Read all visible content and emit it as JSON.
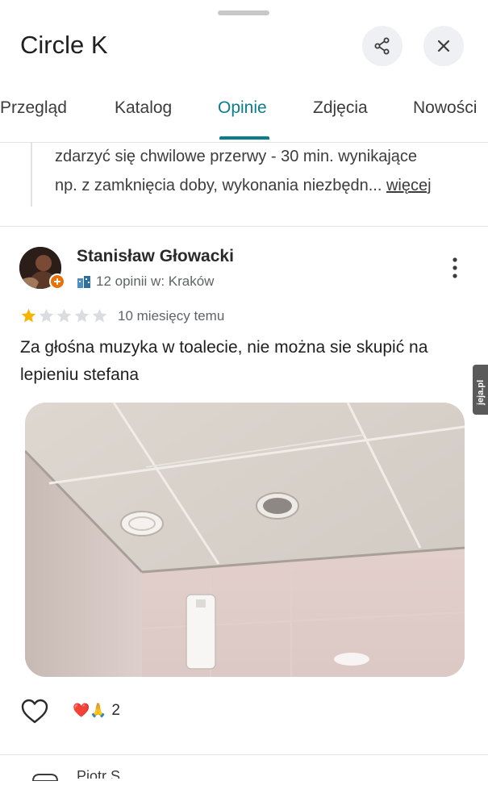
{
  "header": {
    "title": "Circle K"
  },
  "tabs": [
    {
      "label": "Przegląd"
    },
    {
      "label": "Katalog"
    },
    {
      "label": "Opinie"
    },
    {
      "label": "Zdjęcia"
    },
    {
      "label": "Nowości"
    }
  ],
  "active_tab": "Opinie",
  "accent_color": "#0b7d8a",
  "previous_review": {
    "line1": "zdarzyć się chwilowe przerwy - 30 min. wynikające",
    "line2": "np. z zamknięcia doby, wykonania niezbędn...",
    "more_label": "więcej"
  },
  "review": {
    "author": "Stanisław Głowacki",
    "meta": "12 opinii w: Kraków",
    "rating": 1,
    "rating_max": 5,
    "date": "10 miesięcy temu",
    "text": "Za głośna muzyka w toalecie, nie można sie skupić na lepieniu stefana",
    "reactions": {
      "emojis": "❤️🙏",
      "count": "2"
    }
  },
  "watermark": "jeja.pl",
  "next_review": {
    "author_partial": "Piotr S"
  },
  "icons": {
    "share": "share-icon",
    "close": "close-icon",
    "more": "more-vert-icon",
    "like": "heart-outline-icon",
    "local_guide": "local-guide-badge-icon"
  }
}
